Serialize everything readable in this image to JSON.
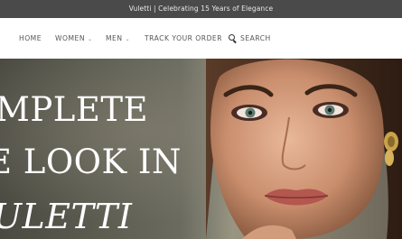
{
  "announcement": "Vuletti | Celebrating 15 Years of Elegance",
  "nav": {
    "home": "HOME",
    "women": "WOMEN",
    "men": "MEN",
    "track_order": "TRACK YOUR ORDER",
    "search": "SEARCH"
  },
  "hero": {
    "line1": "MPLETE",
    "line2": "E LOOK IN",
    "line3": "ULETTI"
  },
  "colors": {
    "topbar_bg": "#4a4a4a",
    "hero_text": "#ffffff"
  }
}
